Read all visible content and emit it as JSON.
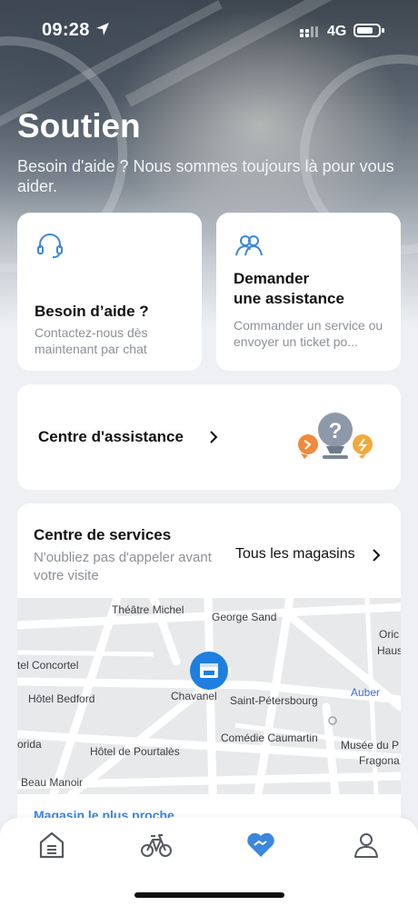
{
  "status_bar": {
    "time": "09:28",
    "network": "4G",
    "location_icon": "location-arrow-icon",
    "signal_icon": "signal-icon",
    "battery_icon": "battery-icon"
  },
  "header": {
    "title": "Soutien",
    "subtitle": "Besoin d'aide ? Nous sommes toujours là pour vous aider."
  },
  "cards": {
    "help": {
      "icon": "headset-icon",
      "title": "Besoin d’aide ?",
      "description": "Contactez-nous dès maintenant par chat"
    },
    "assist": {
      "icon": "people-icon",
      "title_line1": "Demander",
      "title_line2": "une assistance",
      "description": "Commander un service ou envoyer un ticket po..."
    },
    "center": {
      "label": "Centre d'assistance",
      "illustration": "help-bubbles-illustration"
    }
  },
  "services": {
    "title": "Centre de services",
    "description": "N'oubliez pas d'appeler avant votre visite",
    "all_stores": "Tous les magasins",
    "nearest": "Magasin le plus proche",
    "map": {
      "places": [
        "Théâtre Michel",
        "George Sand",
        "Oric",
        "Haus",
        "tel Concortel",
        "Hôtel Bedford",
        "Chavanel",
        "Saint-Pétersbourg",
        "Auber",
        "orida",
        "Hôtel de Pourtalès",
        "Comédie Caumartin",
        "Musée du P",
        "Fragona",
        "Beau Manoir"
      ]
    }
  },
  "colors": {
    "accent": "#3c86de",
    "pin": "#1e7fe0"
  },
  "tabs": [
    {
      "name": "home",
      "icon": "home-icon",
      "active": false
    },
    {
      "name": "bike",
      "icon": "bike-icon",
      "active": false
    },
    {
      "name": "support",
      "icon": "heart-handshake-icon",
      "active": true
    },
    {
      "name": "profile",
      "icon": "user-icon",
      "active": false
    }
  ]
}
